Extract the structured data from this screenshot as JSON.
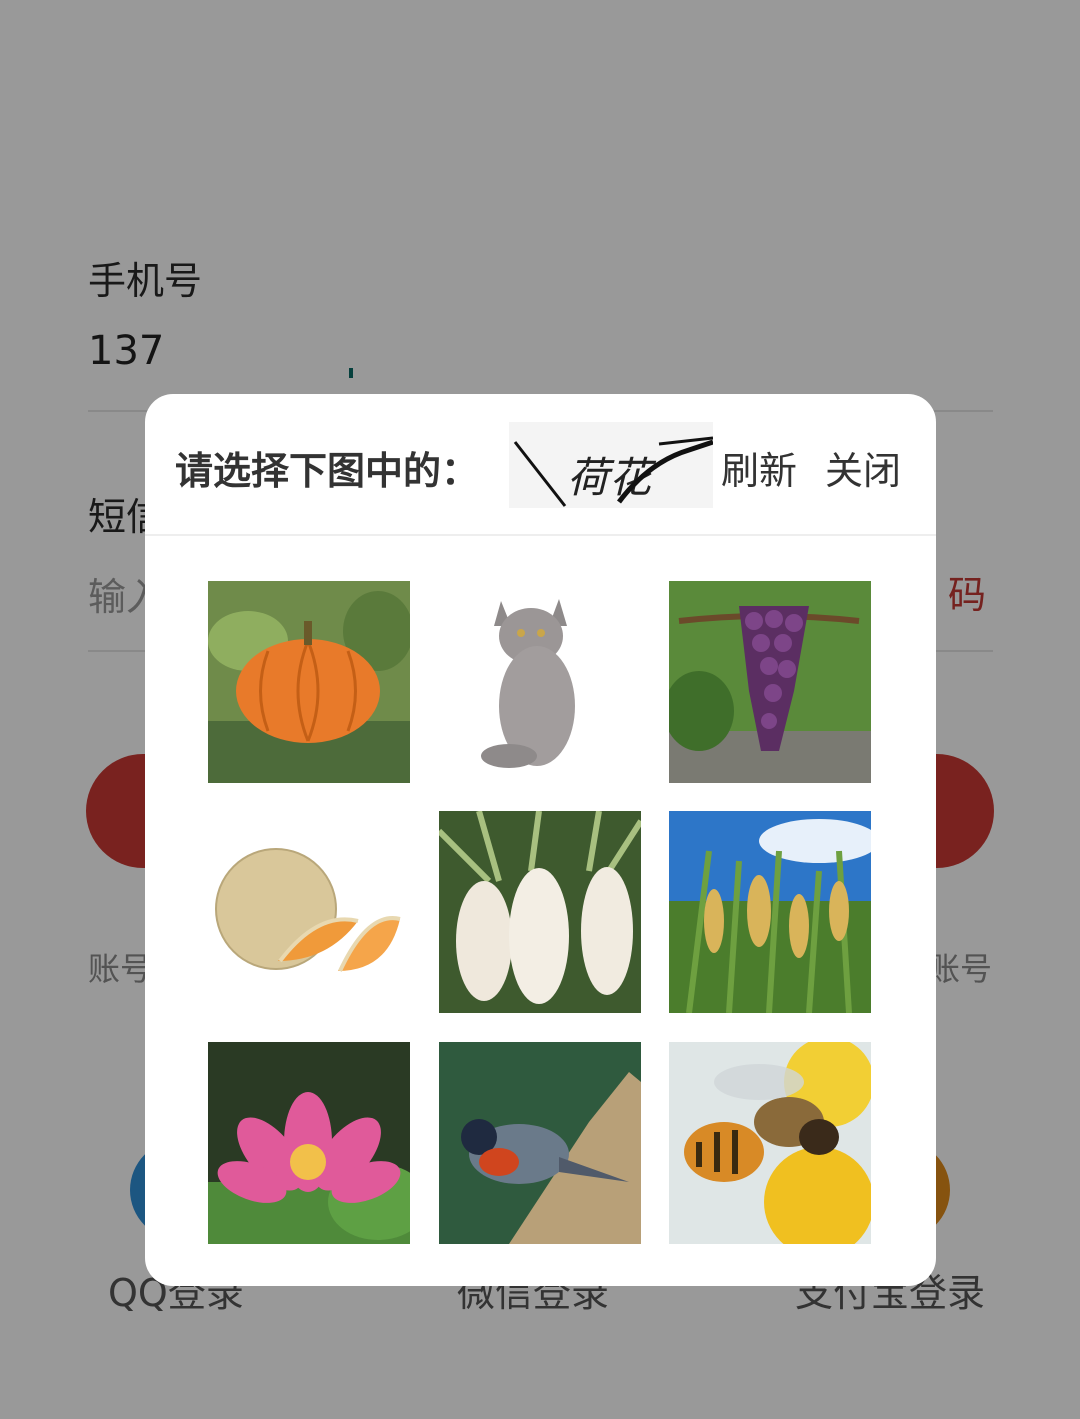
{
  "form": {
    "phone_label": "手机号",
    "phone_value": "137",
    "sms_label_partial": "短信",
    "sms_placeholder_partial": "输入",
    "get_code_partial": "码",
    "account_left_partial": "账号",
    "account_right_partial": "账号"
  },
  "social": {
    "qq_label": "QQ登录",
    "wechat_label": "微信登录",
    "alipay_label": "支付宝登录"
  },
  "dialog": {
    "title": "请选择下图中的：",
    "captcha_text": "荷花",
    "refresh_label": "刷新",
    "close_label": "关闭",
    "tiles": [
      {
        "name": "pumpkin"
      },
      {
        "name": "cat"
      },
      {
        "name": "grapes"
      },
      {
        "name": "cantaloupe"
      },
      {
        "name": "radish"
      },
      {
        "name": "rice"
      },
      {
        "name": "lotus"
      },
      {
        "name": "bird"
      },
      {
        "name": "bee"
      }
    ]
  },
  "colors": {
    "accent_red": "#ca3a34",
    "qq_blue": "#2f8fd8",
    "alipay_orange": "#e08a1a"
  }
}
